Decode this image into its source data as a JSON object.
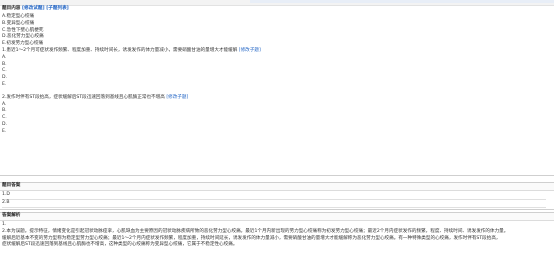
{
  "question_section": {
    "title": "题目内容",
    "edit_link": "[修改试题]",
    "sub_list_link": "[子题列表]",
    "options": [
      "A.稳定型心绞痛",
      "B.变异型心绞痛",
      "C.急性下壁心肌梗死",
      "D.恶化劳力型心绞痛",
      "E.初发劳力型心绞痛"
    ],
    "sub1": {
      "stem": "1.患近1～2个月可症状发作频繁、程度加重、持续时间长，诱发发作的体力量减小，需要硝酸甘油的量增大才能缓解",
      "edit_link": "[修改子题]",
      "choices": [
        "A.",
        "B.",
        "C.",
        "D.",
        "E."
      ]
    },
    "sub2": {
      "stem": "2.发作时伴有ST段抬高，症状缓解后ST段迅速回落到基线且心肌酶正常也不增高",
      "edit_link": "[修改子题]",
      "choices": [
        "A.",
        "B.",
        "C.",
        "D.",
        "E."
      ]
    }
  },
  "answer_section": {
    "title": "题目答案",
    "answers": [
      "1.D",
      "2.B"
    ]
  },
  "analysis_section": {
    "title": "答案解析",
    "lines": [
      "1.",
      "2.本为误题。提示特征，情绪变化是引起冠状动脉痉挛，心肌缺血为主要原因的冠状动脉疾病所致的恶化劳力型心绞痛。最近1个月内新出现的劳力型心绞痛称为初发劳力型心绞痛；最近2个月内症状发作的频繁，程度、持续时间、诱发发作的体力量。",
      "缓解后近基本不变的劳力型称为稳定型劳力型心绞痛；最近1～2个月内症状发作频繁，程度加重，持续时间延长，诱发发作的体力量减小，需要硝酸甘油的量增大才能缓解称为恶化劳力型心绞痛。有一种特殊类型的心绞痛，发作时伴有ST段抬高，",
      "症状缓解后ST段迅速回落到基线且心肌酶也不增高，这种类型的心绞痛称为变异型心绞痛，它属于不稳定性心绞痛。"
    ]
  }
}
